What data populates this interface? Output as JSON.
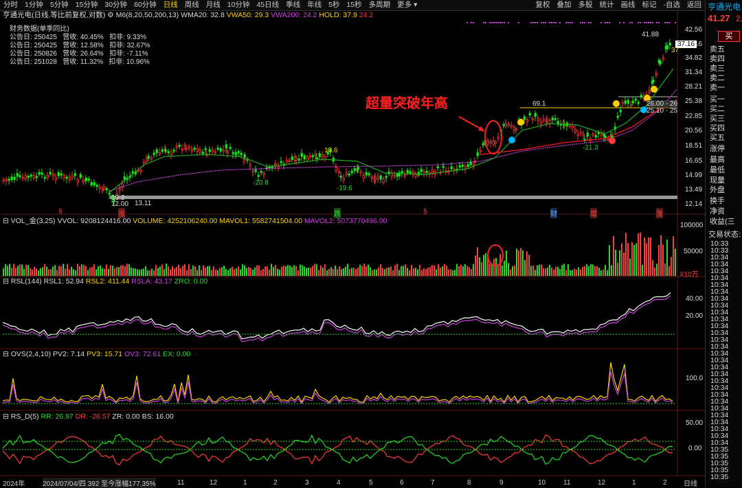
{
  "toolbar": {
    "periods": [
      "分时",
      "1分钟",
      "5分钟",
      "15分钟",
      "30分钟",
      "60分钟",
      "日线",
      "周线",
      "月线",
      "10分钟",
      "45日线",
      "季线",
      "年线",
      "5秒",
      "15秒",
      "多周期",
      "更多 ▾"
    ],
    "active_period": "日线",
    "right_items": [
      "复权",
      "叠加",
      "多股",
      "统计",
      "画线",
      "标记",
      "-自选",
      "返回"
    ]
  },
  "header": {
    "title": "亨通光电(日线,等比前复权,对数)",
    "ma_label": "M6(8,20,50,200,13)",
    "wma20": "WMA20: 32.8",
    "vwa50": "VWA50: 29.3",
    "vwa200": "VWA200: 24.2",
    "hold": "HOLD: 37.9",
    "hold2": "24.2"
  },
  "financial": {
    "title": "财务数据(单季同比)",
    "rows": [
      "公告日: 250425   营收: 40.45%   扣非: 9.33%",
      "公告日: 250425   营收: 12.58%   扣非: 32.67%",
      "公告日: 250826   营收: 26.64%   扣非: -7.11%",
      "公告日: 251028   营收: 11.32%   扣非: 10.96%"
    ]
  },
  "annotation": "超量突破年高",
  "price_axis": [
    "42.56",
    "37.16",
    "34.82",
    "31.34",
    "28.21",
    "25.38",
    "22.85",
    "20.56",
    "18.51",
    "16.65",
    "14.99",
    "13.49",
    "12.14"
  ],
  "price_labels": {
    "high": "41.88",
    "last": "37.16",
    "level_69": "69.1",
    "low1": "12.00",
    "low2": "13.11",
    "low1b": "13.2",
    "n20": "-20.8",
    "n19": "-19.6",
    "n21": "-21.3",
    "p18": "18.6",
    "l26": "26.00 - 26",
    "l25": "25.10 - 25",
    "n37": "37"
  },
  "volume": {
    "header_name": "VOL_金(3,25)",
    "vvol": "VVOL: 9208124416.00",
    "volume": "VOLUME: 4252106240.00",
    "mavol1": "MAVOL1: 5582741504.00",
    "mavol2": "MAVOL2: 5073770496.00",
    "axis": [
      "100000",
      "50000",
      "X10万"
    ]
  },
  "rsl": {
    "name": "RSL(144)",
    "rsl1": "RSL1: 52.94",
    "rsl2": "RSL2: 411.44",
    "rsla": "RSLA: 43.17",
    "zro": "ZRO: 0.00",
    "axis": [
      "40.00",
      "20.00"
    ]
  },
  "ovs": {
    "name": "OVS(2,4,10)",
    "pv2": "PV2: 7.14",
    "pv3": "PV3: 15.71",
    "ov3": "OV3: 72.61",
    "ex": "EX: 0.00",
    "axis": [
      "100.0"
    ]
  },
  "rsd": {
    "name": "RS_D(5)",
    "rr": "RR: 26.97",
    "dr": "DR: -26.57",
    "zr": "ZR: 0.00",
    "bs": "BS: 16.00",
    "axis": [
      "50.00",
      "0.00"
    ]
  },
  "markers": [
    "§",
    "涨",
    "跌",
    "§",
    "财",
    "增",
    "涨"
  ],
  "bottom": {
    "year": "2024年",
    "info": "2024/07/04/四 392 至今涨幅177.35%",
    "months": [
      "11",
      "12",
      "1",
      "2",
      "3",
      "4",
      "5",
      "6",
      "7",
      "8",
      "9",
      "10",
      "11",
      "12",
      "1",
      "2"
    ],
    "right": "日线"
  },
  "rightpanel": {
    "stock_name": "亨通光电",
    "price": "41.27",
    "change_prefix": "2.",
    "buy_button": "买",
    "sell_levels": [
      "卖五",
      "卖四",
      "卖三",
      "卖二",
      "卖一"
    ],
    "buy_levels": [
      "买一",
      "买二",
      "买三",
      "买四",
      "买五"
    ],
    "stats": [
      "涨停",
      "最高",
      "最低",
      "现量",
      "外盘",
      "换手",
      "净资",
      "收益(三"
    ],
    "trade_status": "交易状态:",
    "times": [
      "10:33",
      "10:33",
      "10:34",
      "10:34",
      "10:34",
      "10:34",
      "10:34",
      "10:34",
      "10:34",
      "10:34",
      "10:34",
      "10:34",
      "10:34",
      "10:34",
      "10:34",
      "10:34",
      "10:34",
      "10:34",
      "10:34",
      "10:34",
      "10:34",
      "10:34",
      "10:34",
      "10:34",
      "10:34",
      "10:34",
      "10:34",
      "10:34",
      "10:34",
      "10:34",
      "10:35",
      "10:35",
      "10:35",
      "10:35",
      "10:35"
    ]
  },
  "colors": {
    "up": "#ff3b3b",
    "down": "#22dd22",
    "ma_yellow": "#ffd400",
    "ma_purple": "#d040e0",
    "accent": "#00b4ff"
  }
}
